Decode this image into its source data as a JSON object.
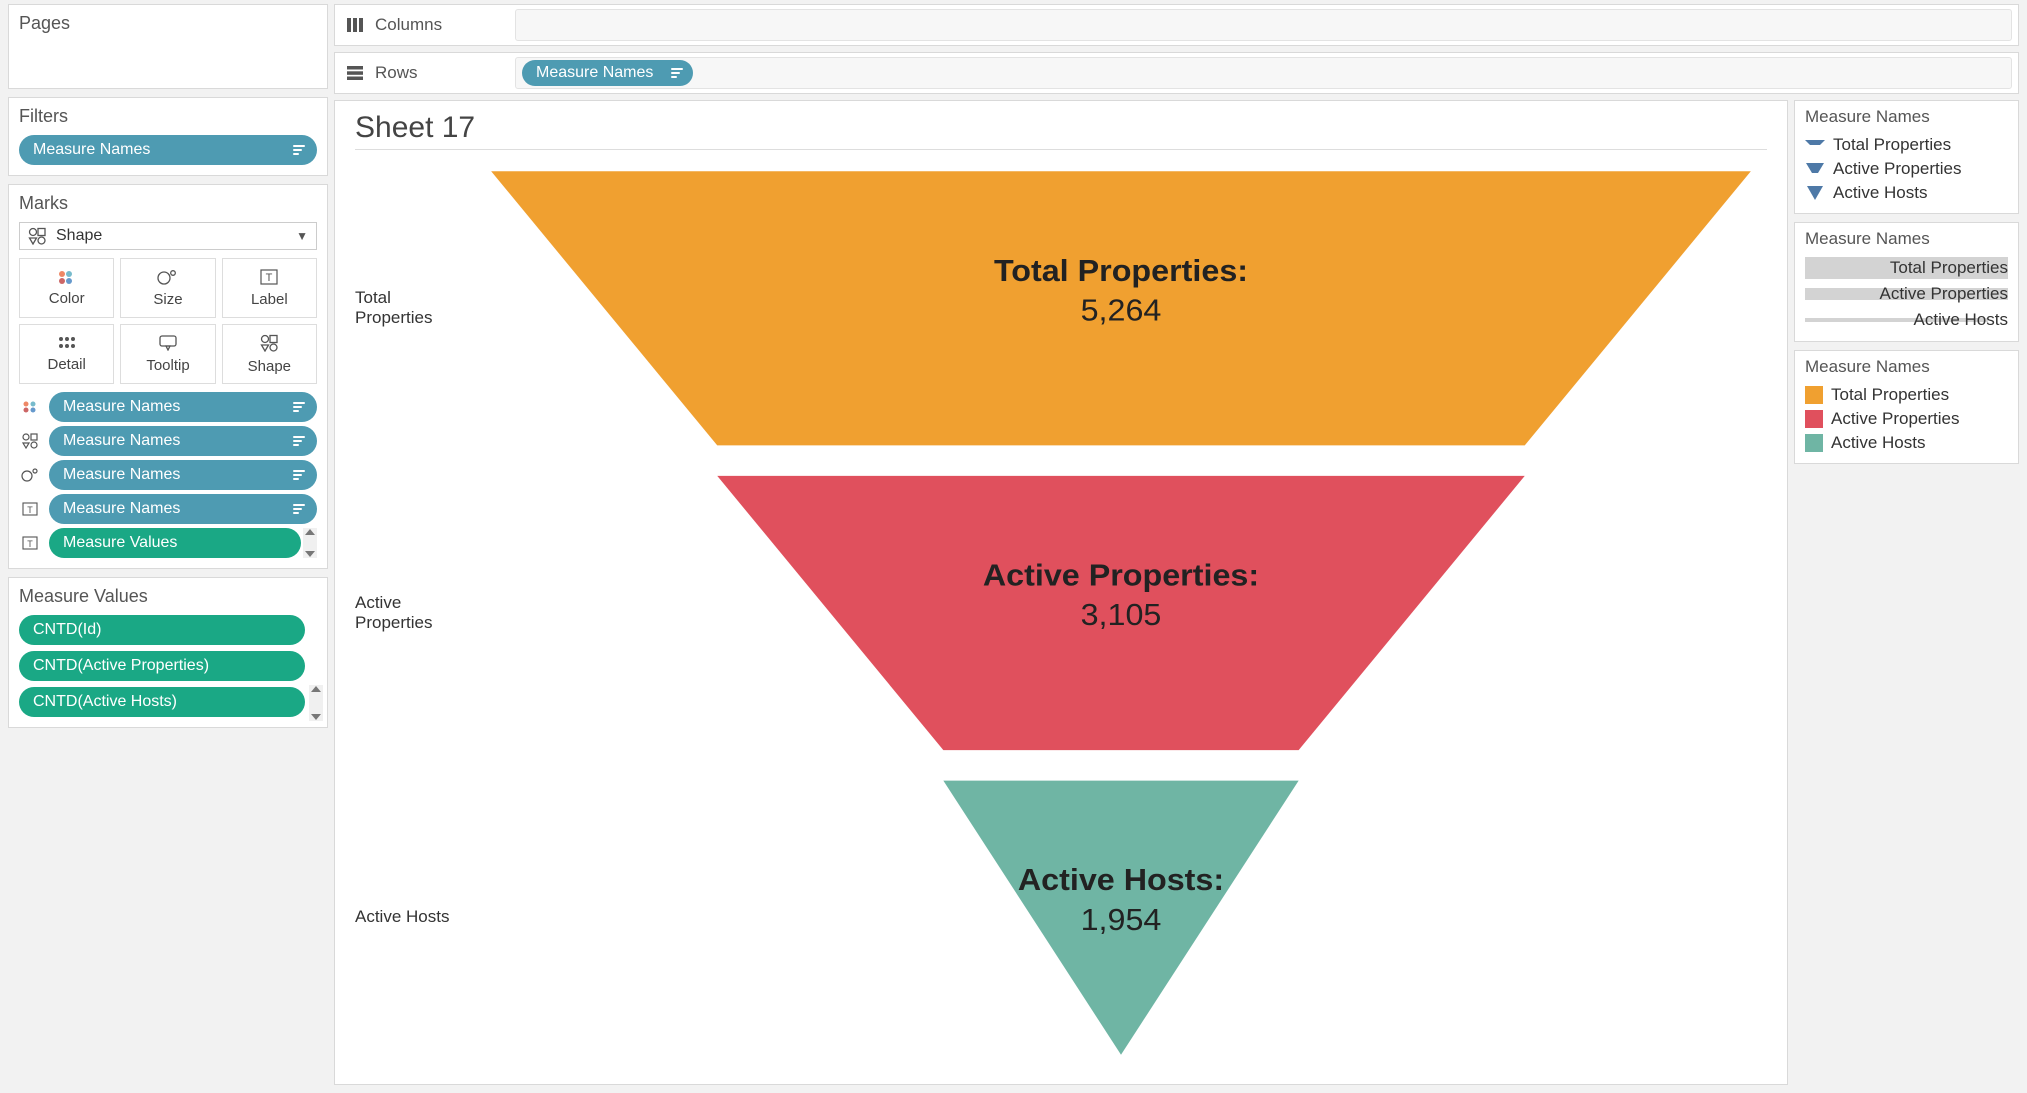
{
  "sidebar": {
    "pages_title": "Pages",
    "filters_title": "Filters",
    "filters_pill": "Measure Names",
    "marks_title": "Marks",
    "mark_type": "Shape",
    "mark_buttons": {
      "color": "Color",
      "size": "Size",
      "label": "Label",
      "detail": "Detail",
      "tooltip": "Tooltip",
      "shape": "Shape"
    },
    "mark_pills": [
      {
        "icon": "color-icon",
        "label": "Measure Names",
        "color": "blue"
      },
      {
        "icon": "shape-icon",
        "label": "Measure Names",
        "color": "blue"
      },
      {
        "icon": "size-icon",
        "label": "Measure Names",
        "color": "blue"
      },
      {
        "icon": "label-t-icon",
        "label": "Measure Names",
        "color": "blue"
      },
      {
        "icon": "label-t-icon",
        "label": "Measure Values",
        "color": "green"
      }
    ],
    "mv_title": "Measure Values",
    "mv_pills": [
      "CNTD(Id)",
      "CNTD(Active Properties)",
      "CNTD(Active Hosts)"
    ]
  },
  "shelves": {
    "columns_label": "Columns",
    "rows_label": "Rows",
    "rows_pill": "Measure Names"
  },
  "viz": {
    "sheet_title": "Sheet 17",
    "funnel": {
      "rows": [
        {
          "label": "Total\nProperties",
          "mark_label": "Total Properties:",
          "value_text": "5,264",
          "value": 5264,
          "color": "#f0a030",
          "half_width": 390
        },
        {
          "label": "Active\nProperties",
          "mark_label": "Active Properties:",
          "value_text": "3,105",
          "value": 3105,
          "color": "#e0505d",
          "half_width": 250
        },
        {
          "label": "Active Hosts",
          "mark_label": "Active Hosts:",
          "value_text": "1,954",
          "value": 1954,
          "color": "#6fb5a4",
          "half_width": 110
        }
      ]
    }
  },
  "legends": {
    "shape": {
      "title": "Measure Names",
      "items": [
        {
          "label": "Total Properties"
        },
        {
          "label": "Active Properties"
        },
        {
          "label": "Active Hosts"
        }
      ]
    },
    "size": {
      "title": "Measure Names",
      "items": [
        {
          "label": "Total Properties",
          "bar": 22
        },
        {
          "label": "Active Properties",
          "bar": 12
        },
        {
          "label": "Active Hosts",
          "bar": 4
        }
      ]
    },
    "color": {
      "title": "Measure Names",
      "items": [
        {
          "label": "Total Properties",
          "swatch": "orange"
        },
        {
          "label": "Active Properties",
          "swatch": "red"
        },
        {
          "label": "Active Hosts",
          "swatch": "teal"
        }
      ]
    }
  },
  "chart_data": {
    "type": "bar",
    "title": "Sheet 17",
    "categories": [
      "Total Properties",
      "Active Properties",
      "Active Hosts"
    ],
    "values": [
      5264,
      3105,
      1954
    ],
    "series": [
      {
        "name": "Total Properties",
        "value": 5264,
        "color": "#f0a030"
      },
      {
        "name": "Active Properties",
        "value": 3105,
        "color": "#e0505d"
      },
      {
        "name": "Active Hosts",
        "value": 1954,
        "color": "#6fb5a4"
      }
    ],
    "xlabel": "",
    "ylabel": ""
  }
}
